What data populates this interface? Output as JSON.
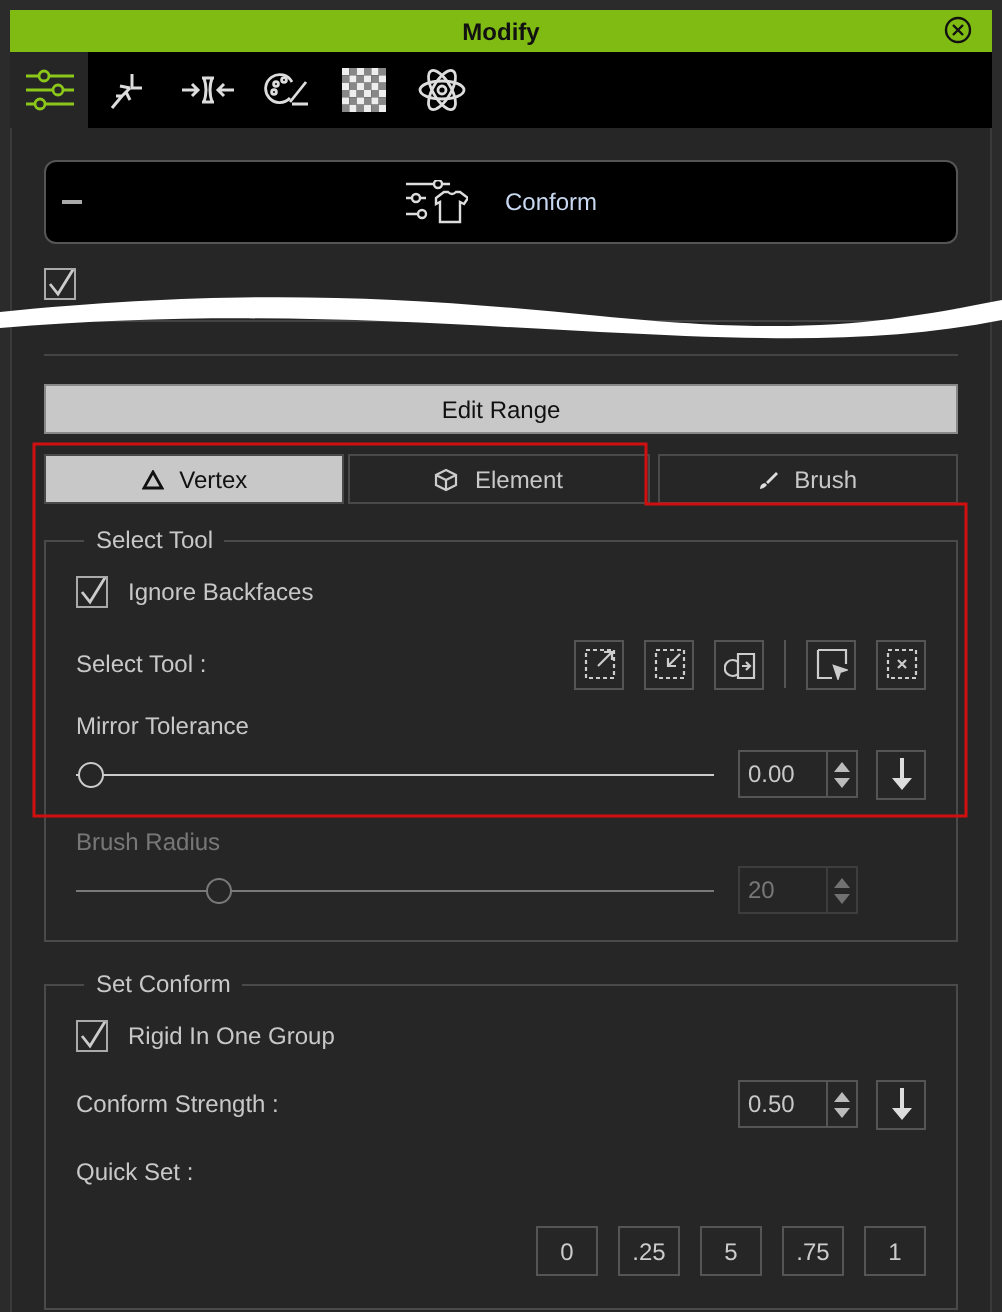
{
  "window": {
    "title": "Modify"
  },
  "toolbar_tabs": [
    {
      "selected": true
    },
    {
      "selected": false
    },
    {
      "selected": false
    },
    {
      "selected": false
    },
    {
      "selected": false
    },
    {
      "selected": false
    }
  ],
  "section": {
    "title": "Conform",
    "expanded": true
  },
  "enable_checkbox": {
    "checked": true
  },
  "edit_range_button": "Edit Range",
  "range_tabs": [
    {
      "label": "Vertex",
      "selected": true
    },
    {
      "label": "Element",
      "selected": false
    },
    {
      "label": "Brush",
      "selected": false
    }
  ],
  "select_tool_group": {
    "title": "Select Tool",
    "ignore_backfaces": {
      "label": "Ignore Backfaces",
      "checked": true
    },
    "select_tool_label": "Select Tool :",
    "mirror_tolerance": {
      "label": "Mirror Tolerance",
      "level": 0,
      "value": "0.00"
    }
  },
  "brush_radius": {
    "label": "Brush Radius",
    "disabled": true,
    "level": 0.21,
    "value": "20"
  },
  "set_conform": {
    "title": "Set Conform",
    "rigid": {
      "label": "Rigid In One Group",
      "checked": true
    },
    "strength": {
      "label": "Conform Strength :",
      "value": "0.50"
    },
    "quick_set": {
      "label": "Quick Set :",
      "buttons": [
        "0",
        ".25",
        "5",
        ".75",
        "1"
      ]
    }
  }
}
